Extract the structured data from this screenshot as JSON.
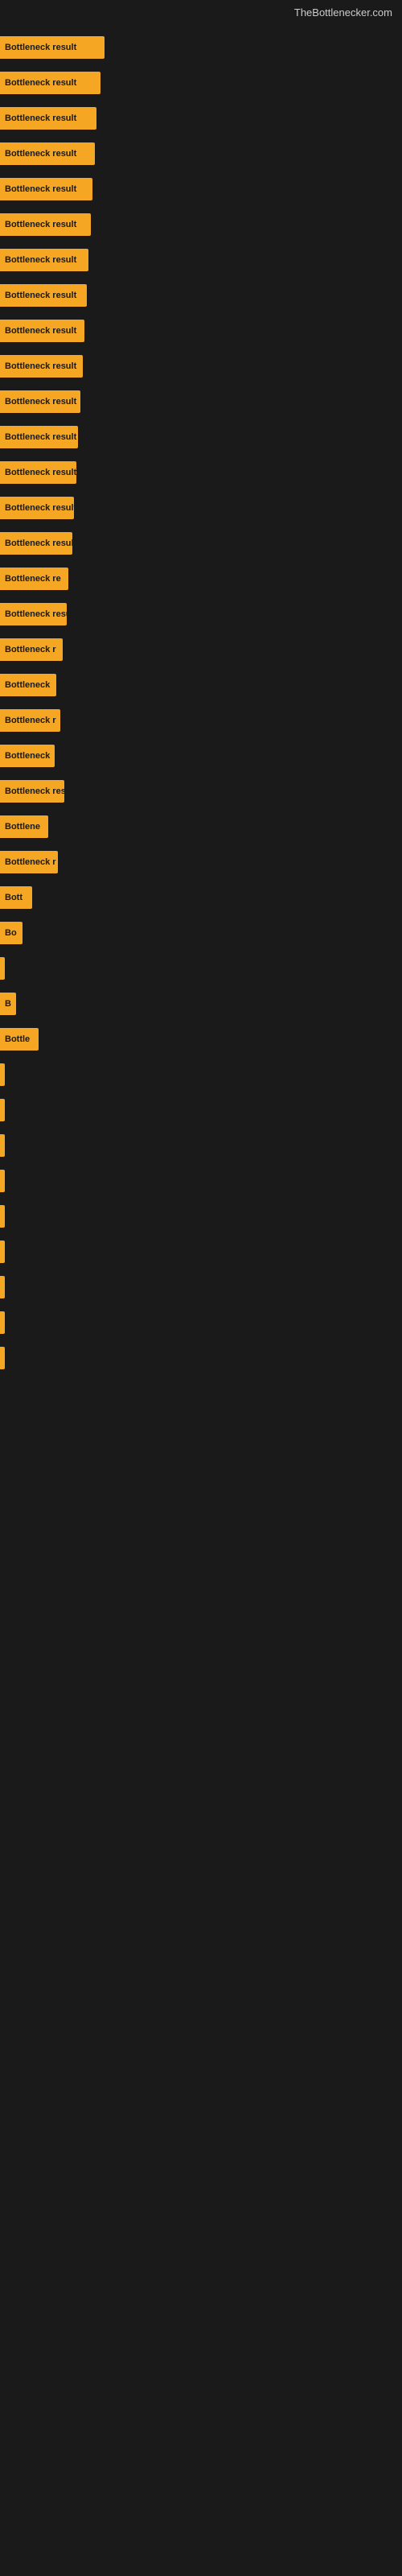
{
  "site_title": "TheBottlenecker.com",
  "bars": [
    {
      "label": "Bottleneck result",
      "width": 130
    },
    {
      "label": "Bottleneck result",
      "width": 125
    },
    {
      "label": "Bottleneck result",
      "width": 120
    },
    {
      "label": "Bottleneck result",
      "width": 118
    },
    {
      "label": "Bottleneck result",
      "width": 115
    },
    {
      "label": "Bottleneck result",
      "width": 113
    },
    {
      "label": "Bottleneck result",
      "width": 110
    },
    {
      "label": "Bottleneck result",
      "width": 108
    },
    {
      "label": "Bottleneck result",
      "width": 105
    },
    {
      "label": "Bottleneck result",
      "width": 103
    },
    {
      "label": "Bottleneck result",
      "width": 100
    },
    {
      "label": "Bottleneck result",
      "width": 97
    },
    {
      "label": "Bottleneck result",
      "width": 95
    },
    {
      "label": "Bottleneck result",
      "width": 92
    },
    {
      "label": "Bottleneck result",
      "width": 90
    },
    {
      "label": "Bottleneck re",
      "width": 85
    },
    {
      "label": "Bottleneck result",
      "width": 83
    },
    {
      "label": "Bottleneck r",
      "width": 78
    },
    {
      "label": "Bottleneck",
      "width": 70
    },
    {
      "label": "Bottleneck r",
      "width": 75
    },
    {
      "label": "Bottleneck",
      "width": 68
    },
    {
      "label": "Bottleneck res",
      "width": 80
    },
    {
      "label": "Bottlene",
      "width": 60
    },
    {
      "label": "Bottleneck r",
      "width": 72
    },
    {
      "label": "Bott",
      "width": 40
    },
    {
      "label": "Bo",
      "width": 28
    },
    {
      "label": "",
      "width": 6
    },
    {
      "label": "B",
      "width": 20
    },
    {
      "label": "Bottle",
      "width": 48
    },
    {
      "label": "",
      "width": 5
    },
    {
      "label": "",
      "width": 0
    },
    {
      "label": "",
      "width": 0
    },
    {
      "label": "",
      "width": 0
    },
    {
      "label": "",
      "width": 0
    },
    {
      "label": "",
      "width": 0
    },
    {
      "label": "",
      "width": 0
    },
    {
      "label": "",
      "width": 0
    },
    {
      "label": "",
      "width": 0
    }
  ]
}
